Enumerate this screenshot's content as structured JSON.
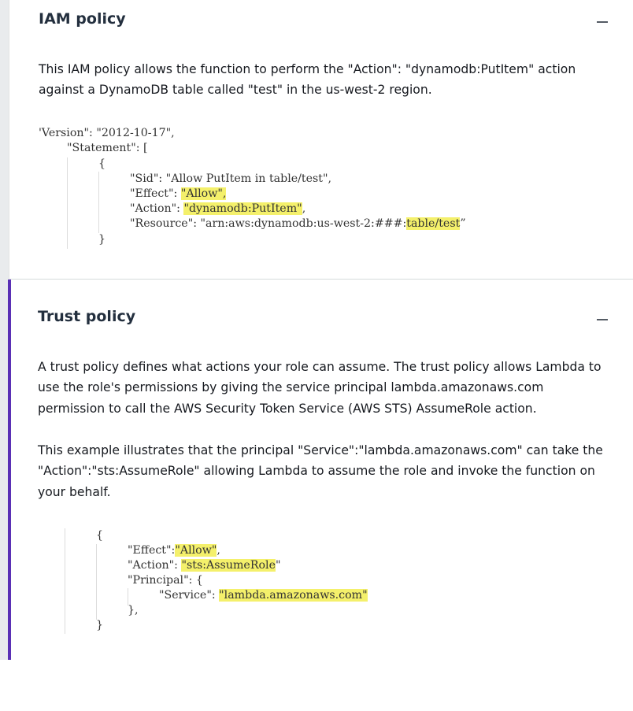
{
  "iam_section": {
    "title": "IAM policy",
    "description": "This IAM policy allows the function to perform the \"Action\": \"dynamodb:PutItem\" action against a DynamoDB table called \"test\" in the us-west-2 region.",
    "code": {
      "l1": "'Version\": \"2012-10-17\",",
      "l2": "\"Statement\": [",
      "l3": "{",
      "l4": "\"Sid\": \"Allow PutItem in table/test\",",
      "l5_key": "\"Effect\": ",
      "l5_val": "\"Allow\",",
      "l6_key": "\"Action\": ",
      "l6_val": "\"dynamodb:PutItem\"",
      "l6_tail": ",",
      "l7_key": "\"Resource\": \"arn:aws:dynamodb:us-west-2:###:",
      "l7_val": "table/test",
      "l7_tail": "”",
      "l8": "}"
    }
  },
  "trust_section": {
    "title": "Trust policy",
    "description_1": "A trust policy defines what actions your role can assume. The trust policy allows Lambda to use the role's permissions by giving the service principal lambda.amazonaws.com permission to call the AWS Security Token Service (AWS STS) AssumeRole action.",
    "description_2": "This example illustrates that the principal \"Service\":\"lambda.amazonaws.com\" can take the \"Action\":\"sts:AssumeRole\" allowing Lambda to assume the role and invoke the function on your behalf.",
    "code": {
      "l1": "{",
      "l2_key": "\"Effect\":",
      "l2_val": "\"Allow\"",
      "l2_tail": ",",
      "l3_key": "\"Action\": ",
      "l3_val": "\"sts:AssumeRole",
      "l3_tail": "\"",
      "l4": "\"Principal\": {",
      "l5_key": "\"Service\": ",
      "l5_val": "\"lambda.amazonaws.com\"",
      "l6": "},",
      "l7": "}"
    }
  },
  "icons": {
    "collapse": "minus-icon"
  },
  "colors": {
    "accent_border": "#5a30b5",
    "highlight": "#f4f06b"
  }
}
